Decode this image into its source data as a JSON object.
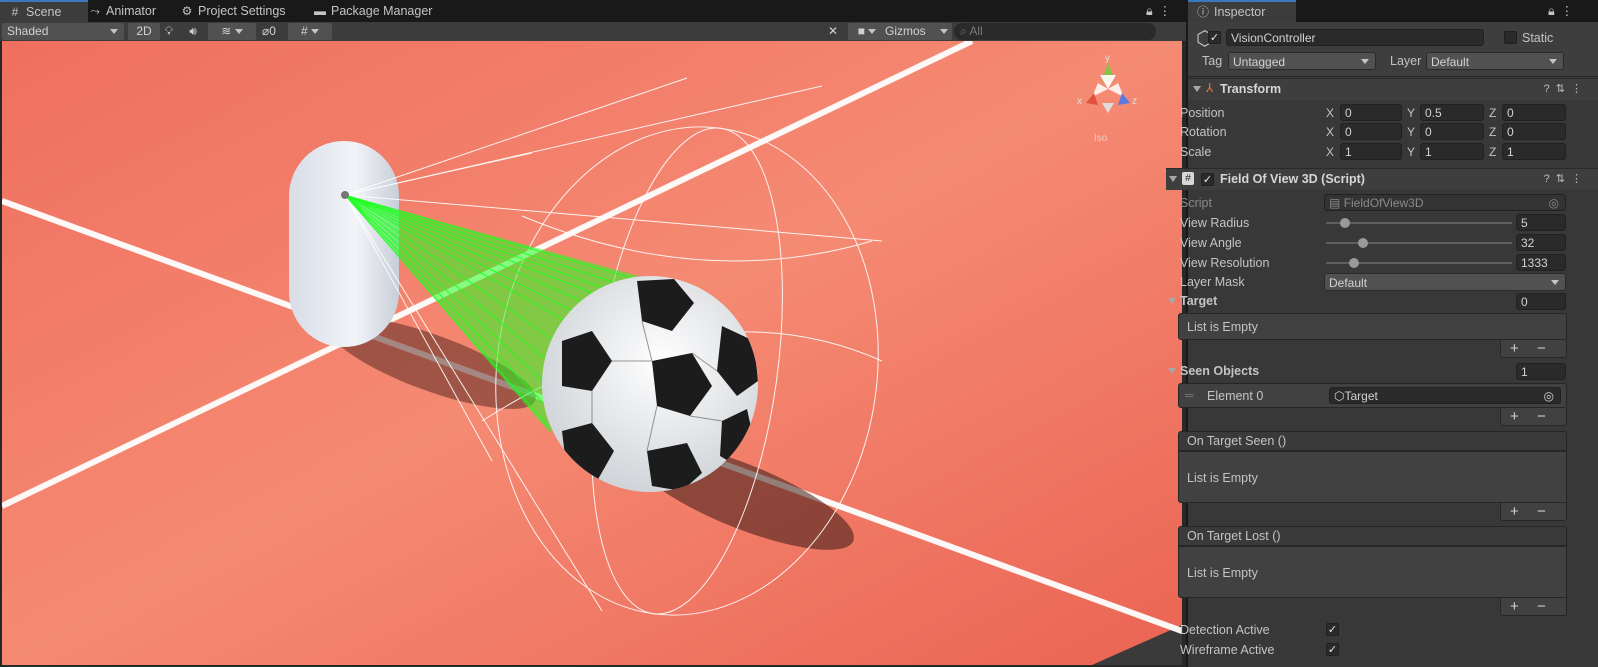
{
  "tabs": [
    {
      "label": "Scene",
      "icon": "grid-icon",
      "active": true
    },
    {
      "label": "Animator",
      "icon": "animator-icon",
      "active": false
    },
    {
      "label": "Project Settings",
      "icon": "gear-icon",
      "active": false
    },
    {
      "label": "Package Manager",
      "icon": "package-icon",
      "active": false
    }
  ],
  "scene_toolbar": {
    "shading_mode": "Shaded",
    "mode_2d": "2D",
    "hidden_count": "0",
    "gizmos": "Gizmos",
    "search_placeholder": "All"
  },
  "viewport": {
    "orientation_gizmo": {
      "y": "y",
      "x": "x",
      "z": "z"
    },
    "projection_label": "Iso"
  },
  "inspector": {
    "tab_label": "Inspector",
    "object_name": "VisionController",
    "static_label": "Static",
    "tag_label": "Tag",
    "tag_value": "Untagged",
    "layer_label": "Layer",
    "layer_value": "Default",
    "transform": {
      "title": "Transform",
      "position": {
        "label": "Position",
        "x": "0",
        "y": "0.5",
        "z": "0"
      },
      "rotation": {
        "label": "Rotation",
        "x": "0",
        "y": "0",
        "z": "0"
      },
      "scale": {
        "label": "Scale",
        "x": "1",
        "y": "1",
        "z": "1"
      },
      "axis_x": "X",
      "axis_y": "Y",
      "axis_z": "Z"
    },
    "fov": {
      "title": "Field Of View 3D (Script)",
      "script_label": "Script",
      "script_value": "FieldOfView3D",
      "view_radius_label": "View Radius",
      "view_radius_value": "5",
      "view_radius_fill": 0.1,
      "view_angle_label": "View Angle",
      "view_angle_value": "32",
      "view_angle_fill": 0.2,
      "view_resolution_label": "View Resolution",
      "view_resolution_value": "1333",
      "view_resolution_fill": 0.15,
      "layer_mask_label": "Layer Mask",
      "layer_mask_value": "Default",
      "target_label": "Target",
      "target_count": "0",
      "target_empty": "List is Empty",
      "seen_objects_label": "Seen Objects",
      "seen_objects_count": "1",
      "element0_label": "Element 0",
      "element0_value": "Target",
      "on_target_seen_label": "On Target Seen ()",
      "on_target_seen_empty": "List is Empty",
      "on_target_lost_label": "On Target Lost ()",
      "on_target_lost_empty": "List is Empty",
      "detection_active_label": "Detection Active",
      "wireframe_active_label": "Wireframe Active",
      "plus": "+",
      "minus": "−"
    }
  },
  "colors": {
    "accent": "#3a79bb",
    "floor": "#f07a66",
    "ray": "#00ff00",
    "panel": "#383838"
  }
}
